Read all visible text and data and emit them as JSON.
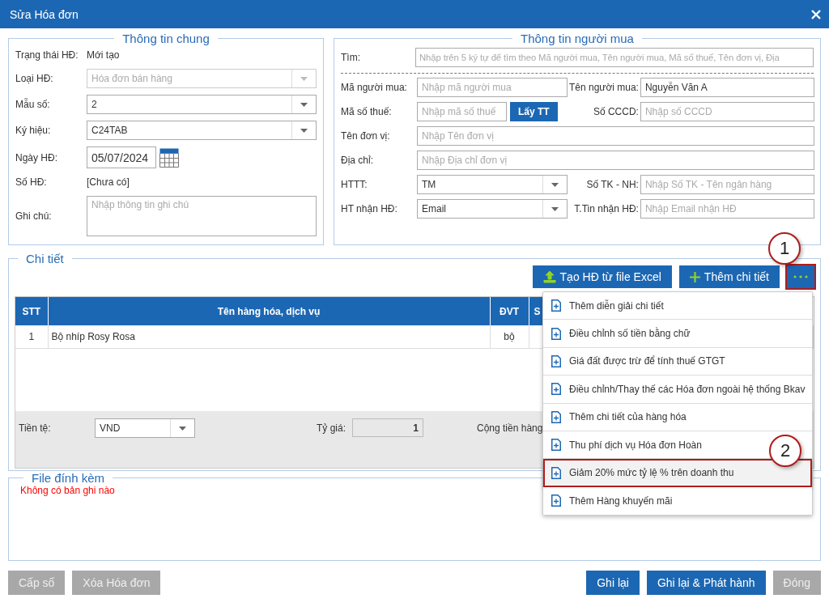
{
  "window": {
    "title": "Sửa Hóa đơn"
  },
  "general": {
    "legend": "Thông tin chung",
    "fields": [
      {
        "kind": "text",
        "label": "Trạng thái HĐ:",
        "value": "Mới tạo"
      },
      {
        "kind": "select",
        "label": "Loại HĐ:",
        "value": "Hóa đơn bán hàng",
        "disabled": true
      },
      {
        "kind": "select",
        "label": "Mẫu số:",
        "value": "2",
        "disabled": false
      },
      {
        "kind": "select",
        "label": "Ký hiệu:",
        "value": "C24TAB",
        "disabled": false
      },
      {
        "kind": "date",
        "label": "Ngày HĐ:",
        "value": "05/07/2024"
      },
      {
        "kind": "text",
        "label": "Số HĐ:",
        "value": "[Chưa có]"
      },
      {
        "kind": "textarea",
        "label": "Ghi chú:",
        "placeholder": "Nhập thông tin ghi chú"
      }
    ]
  },
  "buyer": {
    "legend": "Thông tin người mua",
    "search": {
      "label": "Tìm:",
      "placeholder": "Nhập trên 5 ký tự để tìm theo Mã người mua, Tên người mua, Mã số thuế, Tên đơn vị, Địa"
    },
    "rows": [
      [
        {
          "kind": "input",
          "label": "Mã người mua:",
          "placeholder": "Nhập mã người mua"
        },
        {
          "kind": "input",
          "label": "Tên người mua:",
          "value": "Nguyễn Văn A"
        }
      ],
      [
        {
          "kind": "input_button",
          "label": "Mã số thuế:",
          "placeholder": "Nhập mã số thuế",
          "button": "Lấy TT"
        },
        {
          "kind": "input",
          "label": "Số CCCD:",
          "placeholder": "Nhập số CCCD"
        }
      ],
      [
        {
          "kind": "input",
          "label": "Tên đơn vị:",
          "placeholder": "Nhập Tên đơn vị"
        }
      ],
      [
        {
          "kind": "input",
          "label": "Địa chỉ:",
          "placeholder": "Nhập Địa chỉ đơn vị"
        }
      ],
      [
        {
          "kind": "select",
          "label": "HTTT:",
          "value": "TM"
        },
        {
          "kind": "input",
          "label": "Số TK - NH:",
          "placeholder": "Nhập Số TK - Tên ngân hàng"
        }
      ],
      [
        {
          "kind": "select",
          "label": "HT nhận HĐ:",
          "value": "Email"
        },
        {
          "kind": "input",
          "label": "T.Tin nhận HĐ:",
          "placeholder": "Nhập Email nhận HĐ"
        }
      ]
    ]
  },
  "details": {
    "legend": "Chi tiết",
    "buttons": [
      {
        "label": "Tạo HĐ từ file Excel",
        "kind": "upload"
      },
      {
        "label": "Thêm chi tiết",
        "kind": "plus"
      }
    ],
    "more_button": {
      "highlighted": true
    },
    "table": {
      "columns": [
        "STT",
        "Tên hàng hóa, dịch vụ",
        "ĐVT",
        "S"
      ],
      "rows": [
        {
          "cells": [
            "1",
            "Bộ nhíp Rosy Rosa",
            "bộ"
          ]
        }
      ]
    },
    "footer": {
      "currency_label": "Tiền tệ:",
      "currency": "VND",
      "rate_label": "Tỷ giá:",
      "rate": "1",
      "total_label": "Cộng tiền hàng"
    },
    "menu": [
      {
        "label": "Thêm diễn giải chi tiết",
        "selected": false
      },
      {
        "label": "Điều chỉnh số tiền bằng chữ",
        "selected": false
      },
      {
        "label": "Giá đất được trừ để tính thuế GTGT",
        "selected": false
      },
      {
        "label": "Điều chỉnh/Thay thế các Hóa đơn ngoài hệ thống Bkav",
        "selected": false
      },
      {
        "label": "Thêm chi tiết của hàng hóa",
        "selected": false
      },
      {
        "label": "Thu phí dịch vụ Hóa đơn Hoàn",
        "selected": false
      },
      {
        "label": "Giảm 20% mức tỷ lệ % trên doanh thu",
        "selected": true
      },
      {
        "label": "Thêm Hàng khuyến mãi",
        "selected": false
      }
    ]
  },
  "attachments": {
    "legend": "File đính kèm",
    "empty": "Không có bản ghi nào"
  },
  "callouts": [
    {
      "label": "1"
    },
    {
      "label": "2"
    }
  ],
  "footer_buttons": {
    "left": [
      {
        "label": "Cấp số",
        "disabled": true
      },
      {
        "label": "Xóa Hóa đơn",
        "disabled": true
      }
    ],
    "right": [
      {
        "label": "Ghi lại",
        "disabled": false
      },
      {
        "label": "Ghi lại & Phát hành",
        "disabled": false
      },
      {
        "label": "Đóng",
        "disabled": true
      }
    ]
  }
}
